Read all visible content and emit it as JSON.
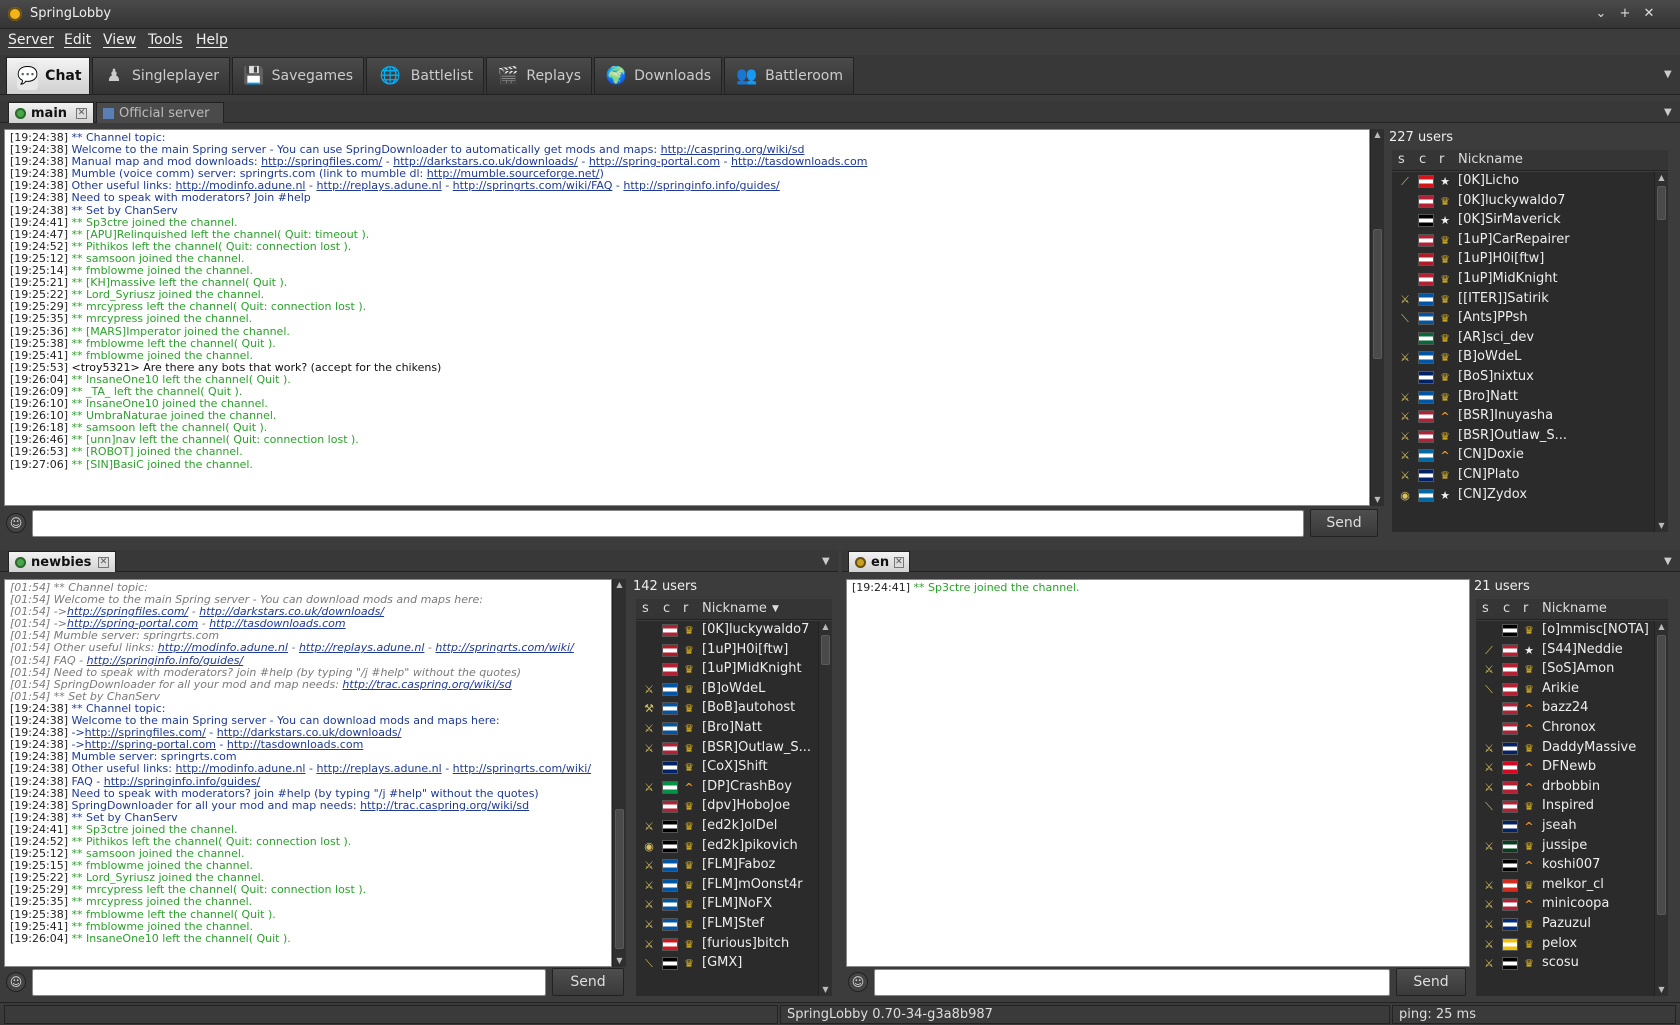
{
  "window": {
    "title": "SpringLobby",
    "min": "⌄",
    "max": "+",
    "close": "✕"
  },
  "menu": [
    "Server",
    "Edit",
    "View",
    "Tools",
    "Help"
  ],
  "tabs": [
    {
      "label": "Chat",
      "icon": "chat-icon",
      "glyph": "💬"
    },
    {
      "label": "Singleplayer",
      "icon": "singleplayer-icon",
      "glyph": "♟"
    },
    {
      "label": "Savegames",
      "icon": "floppy-icon",
      "glyph": "💾"
    },
    {
      "label": "Battlelist",
      "icon": "globe-icon",
      "glyph": "🌐"
    },
    {
      "label": "Replays",
      "icon": "clapper-icon",
      "glyph": "🎬"
    },
    {
      "label": "Downloads",
      "icon": "download-globe-icon",
      "glyph": "🌍"
    },
    {
      "label": "Battleroom",
      "icon": "battleroom-icon",
      "glyph": "👥"
    }
  ],
  "top": {
    "tabs": [
      "main",
      "Official server"
    ],
    "log": [
      {
        "ts": "[19:24:38]",
        "t": "nv",
        "segs": [
          {
            "x": "** Channel topic:"
          }
        ]
      },
      {
        "ts": "[19:24:38]",
        "t": "nv",
        "segs": [
          {
            "x": "Welcome to the main Spring server - You can use SpringDownloader to automatically get mods and maps: "
          },
          {
            "a": "http://caspring.org/wiki/sd"
          }
        ]
      },
      {
        "ts": "[19:24:38]",
        "t": "nv",
        "segs": [
          {
            "x": "Manual map and mod downloads: "
          },
          {
            "a": "http://springfiles.com/"
          },
          {
            "x": " - "
          },
          {
            "a": "http://darkstars.co.uk/downloads/"
          },
          {
            "x": " - "
          },
          {
            "a": "http://spring-portal.com"
          },
          {
            "x": " - "
          },
          {
            "a": "http://tasdownloads.com"
          }
        ]
      },
      {
        "ts": "[19:24:38]",
        "t": "nv",
        "segs": [
          {
            "x": "Mumble (voice comm) server: springrts.com (link to mumble dl: "
          },
          {
            "a": "http://mumble.sourceforge.net/"
          },
          {
            "x": ")"
          }
        ]
      },
      {
        "ts": "[19:24:38]",
        "t": "nv",
        "segs": [
          {
            "x": "Other useful links: "
          },
          {
            "a": "http://modinfo.adune.nl"
          },
          {
            "x": " - "
          },
          {
            "a": "http://replays.adune.nl"
          },
          {
            "x": " - "
          },
          {
            "a": "http://springrts.com/wiki/FAQ"
          },
          {
            "x": " - "
          },
          {
            "a": "http://springinfo.info/guides/"
          }
        ]
      },
      {
        "ts": "[19:24:38]",
        "t": "nv",
        "segs": [
          {
            "x": "Need to speak with moderators? Join #help"
          }
        ]
      },
      {
        "ts": "[19:24:38]",
        "t": "nv",
        "segs": [
          {
            "x": "** Set by ChanServ"
          }
        ]
      },
      {
        "ts": "[19:24:41]",
        "t": "g",
        "segs": [
          {
            "x": "** Sp3ctre joined the channel."
          }
        ]
      },
      {
        "ts": "[19:24:47]",
        "t": "g",
        "segs": [
          {
            "x": "** [APU]Relinquished left the channel( Quit: timeout )."
          }
        ]
      },
      {
        "ts": "[19:24:52]",
        "t": "g",
        "segs": [
          {
            "x": "** Pithikos left the channel( Quit: connection lost )."
          }
        ]
      },
      {
        "ts": "[19:25:12]",
        "t": "g",
        "segs": [
          {
            "x": "** samsoon joined the channel."
          }
        ]
      },
      {
        "ts": "[19:25:14]",
        "t": "g",
        "segs": [
          {
            "x": "** fmblowme joined the channel."
          }
        ]
      },
      {
        "ts": "[19:25:21]",
        "t": "g",
        "segs": [
          {
            "x": "** [KH]massive left the channel( Quit )."
          }
        ]
      },
      {
        "ts": "[19:25:22]",
        "t": "g",
        "segs": [
          {
            "x": "** Lord_Syriusz joined the channel."
          }
        ]
      },
      {
        "ts": "[19:25:29]",
        "t": "g",
        "segs": [
          {
            "x": "** mrcypress left the channel( Quit: connection lost )."
          }
        ]
      },
      {
        "ts": "[19:25:35]",
        "t": "g",
        "segs": [
          {
            "x": "** mrcypress joined the channel."
          }
        ]
      },
      {
        "ts": "[19:25:36]",
        "t": "g",
        "segs": [
          {
            "x": "** [MARS]Imperator joined the channel."
          }
        ]
      },
      {
        "ts": "[19:25:38]",
        "t": "g",
        "segs": [
          {
            "x": "** fmblowme left the channel( Quit )."
          }
        ]
      },
      {
        "ts": "[19:25:41]",
        "t": "g",
        "segs": [
          {
            "x": "** fmblowme joined the channel."
          }
        ]
      },
      {
        "ts": "[19:25:53]",
        "t": "bl",
        "segs": [
          {
            "x": "<troy5321> Are there any bots that work? (accept for the chikens)"
          }
        ]
      },
      {
        "ts": "[19:26:04]",
        "t": "g",
        "segs": [
          {
            "x": "** InsaneOne10 left the channel( Quit )."
          }
        ]
      },
      {
        "ts": "[19:26:09]",
        "t": "g",
        "segs": [
          {
            "x": "** _TA_ left the channel( Quit )."
          }
        ]
      },
      {
        "ts": "[19:26:10]",
        "t": "g",
        "segs": [
          {
            "x": "** InsaneOne10 joined the channel."
          }
        ]
      },
      {
        "ts": "[19:26:10]",
        "t": "g",
        "segs": [
          {
            "x": "** UmbraNaturae joined the channel."
          }
        ]
      },
      {
        "ts": "[19:26:18]",
        "t": "g",
        "segs": [
          {
            "x": "** samsoon left the channel( Quit )."
          }
        ]
      },
      {
        "ts": "[19:26:46]",
        "t": "g",
        "segs": [
          {
            "x": "** [unn]nav left the channel( Quit: connection lost )."
          }
        ]
      },
      {
        "ts": "[19:26:53]",
        "t": "g",
        "segs": [
          {
            "x": "** [ROBOT] joined the channel."
          }
        ]
      },
      {
        "ts": "[19:27:06]",
        "t": "g",
        "segs": [
          {
            "x": "** [SIN]BasiC joined the channel."
          }
        ]
      }
    ],
    "users_count": "227 users",
    "hdr": {
      "s": "s",
      "c": "c",
      "r": "r",
      "nick": "Nickname"
    },
    "users": [
      {
        "s": "⟋",
        "c": "CZ",
        "r": "★",
        "n": "[0K]Licho"
      },
      {
        "s": "",
        "c": "US",
        "r": "🏆",
        "n": "[0K]luckywaldo7"
      },
      {
        "s": "",
        "c": "DE",
        "r": "★",
        "n": "[0K]SirMaverick"
      },
      {
        "s": "",
        "c": "US",
        "r": "🏆",
        "n": "[1uP]CarRepairer"
      },
      {
        "s": "",
        "c": "NL",
        "r": "🏆",
        "n": "[1uP]H0i[ftw]"
      },
      {
        "s": "",
        "c": "US",
        "r": "🏆",
        "n": "[1uP]MidKnight"
      },
      {
        "s": "⚔",
        "c": "FR",
        "r": "🏆",
        "n": "[[ITER]]Satirik"
      },
      {
        "s": "⟍",
        "c": "FR",
        "r": "🏆",
        "n": "[Ants]PPsh"
      },
      {
        "s": "",
        "c": "PT",
        "r": "🏆",
        "n": "[AR]sci_dev"
      },
      {
        "s": "⚔",
        "c": "FR",
        "r": "🏆",
        "n": "[B]oWdeL"
      },
      {
        "s": "",
        "c": "GB",
        "r": "🏆",
        "n": "[BoS]nixtux"
      },
      {
        "s": "⚔",
        "c": "FR",
        "r": "🏆",
        "n": "[Bro]Natt"
      },
      {
        "s": "⚔",
        "c": "US",
        "r": "^",
        "n": "[BSR]Inuyasha"
      },
      {
        "s": "⚔",
        "c": "US",
        "r": "🏆",
        "n": "[BSR]Outlaw_S..."
      },
      {
        "s": "⚔",
        "c": "SE",
        "r": "^",
        "n": "[CN]Doxie"
      },
      {
        "s": "⚔",
        "c": "GB",
        "r": "🏆",
        "n": "[CN]Plato"
      },
      {
        "s": "◉",
        "c": "SE",
        "r": "★",
        "n": "[CN]Zydox"
      }
    ]
  },
  "bottom_left": {
    "tab": "newbies",
    "log": [
      {
        "ts": "[01:54]",
        "t": "gr",
        "segs": [
          {
            "x": " ** Channel topic:"
          }
        ]
      },
      {
        "ts": "[01:54]",
        "t": "gr",
        "segs": [
          {
            "x": " Welcome to the main Spring server - You can download mods and maps here:"
          }
        ]
      },
      {
        "ts": "[01:54]",
        "t": "gr",
        "segs": [
          {
            "x": " ->"
          },
          {
            "a": "http://springfiles.com/"
          },
          {
            "x": " - "
          },
          {
            "a": "http://darkstars.co.uk/downloads/"
          }
        ]
      },
      {
        "ts": "[01:54]",
        "t": "gr",
        "segs": [
          {
            "x": " ->"
          },
          {
            "a": "http://spring-portal.com"
          },
          {
            "x": " - "
          },
          {
            "a": "http://tasdownloads.com"
          }
        ]
      },
      {
        "ts": "[01:54]",
        "t": "gr",
        "segs": [
          {
            "x": "  Mumble server: springrts.com"
          }
        ]
      },
      {
        "ts": "[01:54]",
        "t": "gr",
        "segs": [
          {
            "x": "  Other useful links: "
          },
          {
            "a": "http://modinfo.adune.nl"
          },
          {
            "x": " - "
          },
          {
            "a": "http://replays.adune.nl"
          },
          {
            "x": " - "
          },
          {
            "a": "http://springrts.com/wiki/"
          }
        ]
      },
      {
        "ts": "[01:54]",
        "t": "gr",
        "segs": [
          {
            "x": "  FAQ - "
          },
          {
            "a": "http://springinfo.info/guides/"
          }
        ]
      },
      {
        "ts": "[01:54]",
        "t": "gr",
        "segs": [
          {
            "x": "  Need to speak with moderators? join #help (by typing \"/j #help\" without the quotes)"
          }
        ]
      },
      {
        "ts": "[01:54]",
        "t": "gr",
        "segs": [
          {
            "x": " SpringDownloader for all your mod and map needs: "
          },
          {
            "a": "http://trac.caspring.org/wiki/sd"
          }
        ]
      },
      {
        "ts": "[01:54]",
        "t": "gr",
        "segs": [
          {
            "x": " ** Set by ChanServ"
          }
        ]
      },
      {
        "ts": "[19:24:38]",
        "t": "nv",
        "segs": [
          {
            "x": "** Channel topic:"
          }
        ]
      },
      {
        "ts": "[19:24:38]",
        "t": "nv",
        "segs": [
          {
            "x": "Welcome to the main Spring server - You can download mods and maps here:"
          }
        ]
      },
      {
        "ts": "[19:24:38]",
        "t": "nv",
        "segs": [
          {
            "x": "->"
          },
          {
            "a": "http://springfiles.com/"
          },
          {
            "x": " - "
          },
          {
            "a": "http://darkstars.co.uk/downloads/"
          }
        ]
      },
      {
        "ts": "[19:24:38]",
        "t": "nv",
        "segs": [
          {
            "x": "->"
          },
          {
            "a": "http://spring-portal.com"
          },
          {
            "x": " - "
          },
          {
            "a": "http://tasdownloads.com"
          }
        ]
      },
      {
        "ts": "[19:24:38]",
        "t": "nv",
        "segs": [
          {
            "x": " Mumble server: springrts.com"
          }
        ]
      },
      {
        "ts": "[19:24:38]",
        "t": "nv",
        "segs": [
          {
            "x": " Other useful links: "
          },
          {
            "a": "http://modinfo.adune.nl"
          },
          {
            "x": " - "
          },
          {
            "a": "http://replays.adune.nl"
          },
          {
            "x": " - "
          },
          {
            "a": "http://springrts.com/wiki/"
          }
        ]
      },
      {
        "ts": "[19:24:38]",
        "t": "nv",
        "segs": [
          {
            "x": " FAQ - "
          },
          {
            "a": "http://springinfo.info/guides/"
          }
        ]
      },
      {
        "ts": "[19:24:38]",
        "t": "nv",
        "segs": [
          {
            "x": " Need to speak with moderators? join #help (by typing \"/j #help\" without the quotes)"
          }
        ]
      },
      {
        "ts": "[19:24:38]",
        "t": "nv",
        "segs": [
          {
            "x": "SpringDownloader for all your mod and map needs: "
          },
          {
            "a": "http://trac.caspring.org/wiki/sd"
          }
        ]
      },
      {
        "ts": "[19:24:38]",
        "t": "nv",
        "segs": [
          {
            "x": "** Set by ChanServ"
          }
        ]
      },
      {
        "ts": "[19:24:41]",
        "t": "g",
        "segs": [
          {
            "x": "** Sp3ctre joined the channel."
          }
        ]
      },
      {
        "ts": "[19:24:52]",
        "t": "g",
        "segs": [
          {
            "x": "** Pithikos left the channel( Quit: connection lost )."
          }
        ]
      },
      {
        "ts": "[19:25:12]",
        "t": "g",
        "segs": [
          {
            "x": "** samsoon joined the channel."
          }
        ]
      },
      {
        "ts": "[19:25:15]",
        "t": "g",
        "segs": [
          {
            "x": "** fmblowme joined the channel."
          }
        ]
      },
      {
        "ts": "[19:25:22]",
        "t": "g",
        "segs": [
          {
            "x": "** Lord_Syriusz joined the channel."
          }
        ]
      },
      {
        "ts": "[19:25:29]",
        "t": "g",
        "segs": [
          {
            "x": "** mrcypress left the channel( Quit: connection lost )."
          }
        ]
      },
      {
        "ts": "[19:25:35]",
        "t": "g",
        "segs": [
          {
            "x": "** mrcypress joined the channel."
          }
        ]
      },
      {
        "ts": "[19:25:38]",
        "t": "g",
        "segs": [
          {
            "x": "** fmblowme left the channel( Quit )."
          }
        ]
      },
      {
        "ts": "[19:25:41]",
        "t": "g",
        "segs": [
          {
            "x": "** fmblowme joined the channel."
          }
        ]
      },
      {
        "ts": "[19:26:04]",
        "t": "g",
        "segs": [
          {
            "x": "** InsaneOne10 left the channel( Quit )."
          }
        ]
      }
    ],
    "users_count": "142 users",
    "users": [
      {
        "s": "",
        "c": "US",
        "r": "🏆",
        "n": "[0K]luckywaldo7"
      },
      {
        "s": "",
        "c": "NL",
        "r": "🏆",
        "n": "[1uP]H0i[ftw]"
      },
      {
        "s": "",
        "c": "US",
        "r": "🏆",
        "n": "[1uP]MidKnight"
      },
      {
        "s": "⚔",
        "c": "FR",
        "r": "🏆",
        "n": "[B]oWdeL"
      },
      {
        "s": "⚒",
        "c": "FR",
        "r": "🏆",
        "n": "[BoB]autohost"
      },
      {
        "s": "⚔",
        "c": "FR",
        "r": "🏆",
        "n": "[Bro]Natt"
      },
      {
        "s": "⚔",
        "c": "US",
        "r": "🏆",
        "n": "[BSR]Outlaw_S..."
      },
      {
        "s": "",
        "c": "GB",
        "r": "🏆",
        "n": "[CoX]Shift"
      },
      {
        "s": "⚔",
        "c": "IT",
        "r": "^",
        "n": "[DP]CrashBoy"
      },
      {
        "s": "",
        "c": "US",
        "r": "🏆",
        "n": "[dpv]HoboJoe"
      },
      {
        "s": "⚔",
        "c": "DE",
        "r": "🏆",
        "n": "[ed2k]olDel"
      },
      {
        "s": "◉",
        "c": "DE",
        "r": "🏆",
        "n": "[ed2k]pikovich"
      },
      {
        "s": "⚔",
        "c": "FR",
        "r": "🏆",
        "n": "[FLM]Faboz"
      },
      {
        "s": "⚔",
        "c": "FR",
        "r": "🏆",
        "n": "[FLM]mOonst4r"
      },
      {
        "s": "⚔",
        "c": "FR",
        "r": "🏆",
        "n": "[FLM]NoFX"
      },
      {
        "s": "⚔",
        "c": "FR",
        "r": "🏆",
        "n": "[FLM]Stef"
      },
      {
        "s": "⚔",
        "c": "CZ",
        "r": "🏆",
        "n": "[furious]bitch"
      },
      {
        "s": "⟍",
        "c": "DE",
        "r": "🏆",
        "n": "[GMX]"
      }
    ]
  },
  "bottom_right": {
    "tab": "en",
    "log": [
      {
        "ts": "[19:24:41]",
        "t": "g",
        "segs": [
          {
            "x": "** Sp3ctre joined the channel."
          }
        ]
      }
    ],
    "users_count": "21 users",
    "users": [
      {
        "s": "",
        "c": "DE",
        "r": "🏆",
        "n": "[o]mmisc[NOTA]"
      },
      {
        "s": "⟋",
        "c": "US",
        "r": "★",
        "n": "[S44]Neddie"
      },
      {
        "s": "⚔",
        "c": "US",
        "r": "🏆",
        "n": "[SoS]Amon"
      },
      {
        "s": "⟍",
        "c": "US",
        "r": "🏆",
        "n": "Arikie"
      },
      {
        "s": "",
        "c": "US",
        "r": "^",
        "n": "bazz24"
      },
      {
        "s": "",
        "c": "US",
        "r": "^",
        "n": "Chronox"
      },
      {
        "s": "⚔",
        "c": "GB",
        "r": "🏆",
        "n": "DaddyMassive"
      },
      {
        "s": "⚔",
        "c": "CA",
        "r": "^",
        "n": "DFNewb"
      },
      {
        "s": "⚔",
        "c": "US",
        "r": "^",
        "n": "drbobbin"
      },
      {
        "s": "⟍",
        "c": "US",
        "r": "🏆",
        "n": "Inspired"
      },
      {
        "s": "",
        "c": "AU",
        "r": "^",
        "n": "jseah"
      },
      {
        "s": "⚔",
        "c": "PK",
        "r": "🏆",
        "n": "jussipe"
      },
      {
        "s": "",
        "c": "DE",
        "r": "^",
        "n": "koshi007"
      },
      {
        "s": "⚔",
        "c": "CL",
        "r": "🏆",
        "n": "melkor_cl"
      },
      {
        "s": "⚔",
        "c": "US",
        "r": "^",
        "n": "minicoopa"
      },
      {
        "s": "⚔",
        "c": "RO",
        "r": "🏆",
        "n": "Pazuzul"
      },
      {
        "s": "⚔",
        "c": "VE",
        "r": "🏆",
        "n": "pelox"
      },
      {
        "s": "⚔",
        "c": "DE",
        "r": "🏆",
        "n": "scosu"
      }
    ]
  },
  "send_label": "Send",
  "status": {
    "version": "SpringLobby 0.70-34-g3a8b987",
    "ping": "ping: 25 ms"
  },
  "flag_colors": {
    "US": "#b22234",
    "DE": "#000000",
    "FR": "#0055a4",
    "GB": "#012169",
    "NL": "#ae1c28",
    "CZ": "#d7141a",
    "SE": "#006aa7",
    "PT": "#046a38",
    "IT": "#009246",
    "CA": "#d80621",
    "AU": "#012169",
    "PK": "#01411c",
    "CL": "#d52b1e",
    "RO": "#002b7f",
    "VE": "#f4c300"
  }
}
